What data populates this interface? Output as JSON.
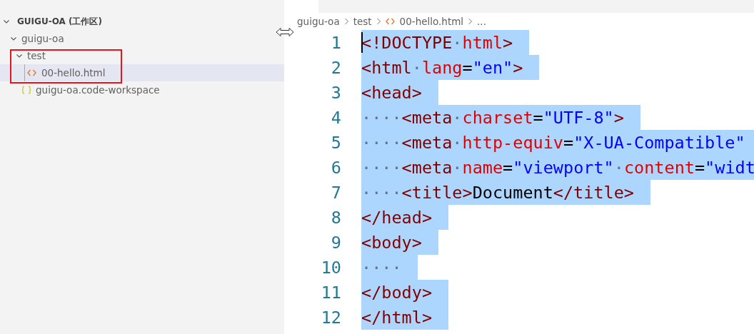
{
  "explorer": {
    "workspace": "GUIGU-OA (工作区)",
    "expanded": true,
    "tree": [
      {
        "kind": "folder",
        "label": "guigu-oa",
        "expanded": true,
        "selected": false,
        "children": [
          {
            "kind": "folder",
            "label": "test",
            "expanded": true,
            "selected": false,
            "children": [
              {
                "kind": "html",
                "label": "00-hello.html",
                "selected": true
              }
            ]
          },
          {
            "kind": "workspace",
            "label": "guigu-oa.code-workspace",
            "selected": false
          }
        ]
      }
    ]
  },
  "breadcrumb": [
    {
      "kind": "folder",
      "label": "guigu-oa"
    },
    {
      "kind": "folder",
      "label": "test"
    },
    {
      "kind": "html",
      "label": "00-hello.html"
    },
    {
      "kind": "more",
      "label": "..."
    }
  ],
  "editor": {
    "lines": [
      {
        "number": "1",
        "selected": true,
        "tokens": [
          {
            "kind": "tag",
            "text": "<!DOCTYPE"
          },
          {
            "kind": "space",
            "text": "·"
          },
          {
            "kind": "attr",
            "text": "html"
          },
          {
            "kind": "tag",
            "text": ">"
          }
        ]
      },
      {
        "number": "2",
        "selected": true,
        "tokens": [
          {
            "kind": "tag",
            "text": "<html"
          },
          {
            "kind": "space",
            "text": "·"
          },
          {
            "kind": "attr",
            "text": "lang"
          },
          {
            "kind": "text",
            "text": "="
          },
          {
            "kind": "value",
            "text": "\"en\""
          },
          {
            "kind": "tag",
            "text": ">"
          }
        ]
      },
      {
        "number": "3",
        "selected": true,
        "tokens": [
          {
            "kind": "tag",
            "text": "<head>"
          }
        ]
      },
      {
        "number": "4",
        "selected": true,
        "tokens": [
          {
            "kind": "space",
            "text": "····"
          },
          {
            "kind": "tag",
            "text": "<meta"
          },
          {
            "kind": "space",
            "text": "·"
          },
          {
            "kind": "attr",
            "text": "charset"
          },
          {
            "kind": "text",
            "text": "="
          },
          {
            "kind": "value",
            "text": "\"UTF-8\""
          },
          {
            "kind": "tag",
            "text": ">"
          }
        ]
      },
      {
        "number": "5",
        "selected": true,
        "tokens": [
          {
            "kind": "space",
            "text": "····"
          },
          {
            "kind": "tag",
            "text": "<meta"
          },
          {
            "kind": "space",
            "text": "·"
          },
          {
            "kind": "attr",
            "text": "http-equiv"
          },
          {
            "kind": "text",
            "text": "="
          },
          {
            "kind": "value",
            "text": "\"X-UA-Compatible\""
          }
        ]
      },
      {
        "number": "6",
        "selected": true,
        "tokens": [
          {
            "kind": "space",
            "text": "····"
          },
          {
            "kind": "tag",
            "text": "<meta"
          },
          {
            "kind": "space",
            "text": "·"
          },
          {
            "kind": "attr",
            "text": "name"
          },
          {
            "kind": "text",
            "text": "="
          },
          {
            "kind": "value",
            "text": "\"viewport\""
          },
          {
            "kind": "space",
            "text": "·"
          },
          {
            "kind": "attr",
            "text": "content"
          },
          {
            "kind": "text",
            "text": "="
          },
          {
            "kind": "value",
            "text": "\"widt"
          }
        ]
      },
      {
        "number": "7",
        "selected": true,
        "tokens": [
          {
            "kind": "space",
            "text": "····"
          },
          {
            "kind": "tag",
            "text": "<title>"
          },
          {
            "kind": "text",
            "text": "Document"
          },
          {
            "kind": "tag",
            "text": "</title>"
          }
        ]
      },
      {
        "number": "8",
        "selected": true,
        "tokens": [
          {
            "kind": "tag",
            "text": "</head>"
          }
        ]
      },
      {
        "number": "9",
        "selected": true,
        "tokens": [
          {
            "kind": "tag",
            "text": "<body>"
          }
        ]
      },
      {
        "number": "10",
        "selected": true,
        "tokens": [
          {
            "kind": "space",
            "text": "····"
          }
        ]
      },
      {
        "number": "11",
        "selected": true,
        "tokens": [
          {
            "kind": "tag",
            "text": "</body>"
          }
        ]
      },
      {
        "number": "12",
        "selected": true,
        "tokens": [
          {
            "kind": "tag",
            "text": "</html>"
          }
        ]
      }
    ]
  }
}
